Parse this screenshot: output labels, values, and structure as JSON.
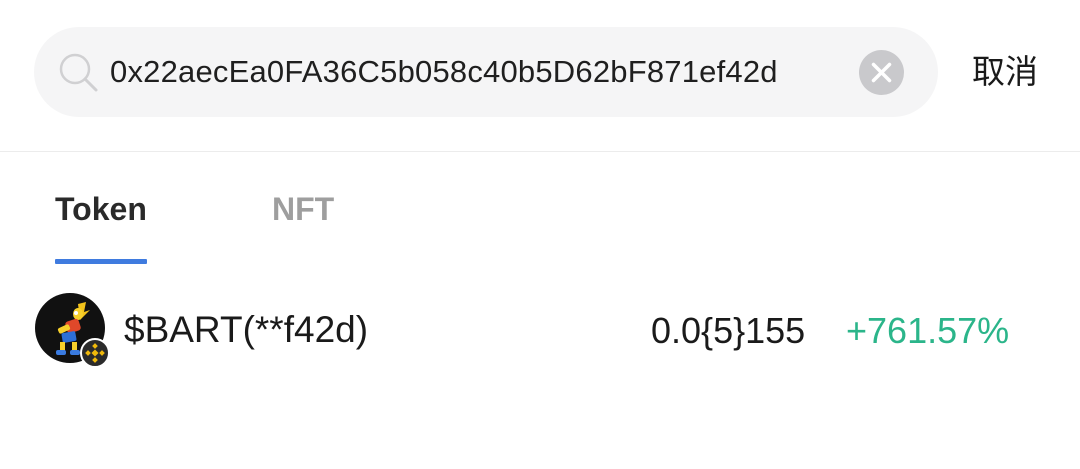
{
  "search": {
    "value": "0x22aecEa0FA36C5b058c40b5D62bF871ef42d",
    "cancel_label": "取消"
  },
  "tabs": [
    {
      "label": "Token",
      "active": true
    },
    {
      "label": "NFT",
      "active": false
    }
  ],
  "results": [
    {
      "name": "$BART(**f42d)",
      "price": "0.0{5}155",
      "change": "+761.57%",
      "chain_badge": "bnb-chain-icon"
    }
  ],
  "colors": {
    "tab_indicator": "#3f7bdf",
    "positive_change": "#2bb58a",
    "inactive_tab": "#9e9e9e"
  }
}
